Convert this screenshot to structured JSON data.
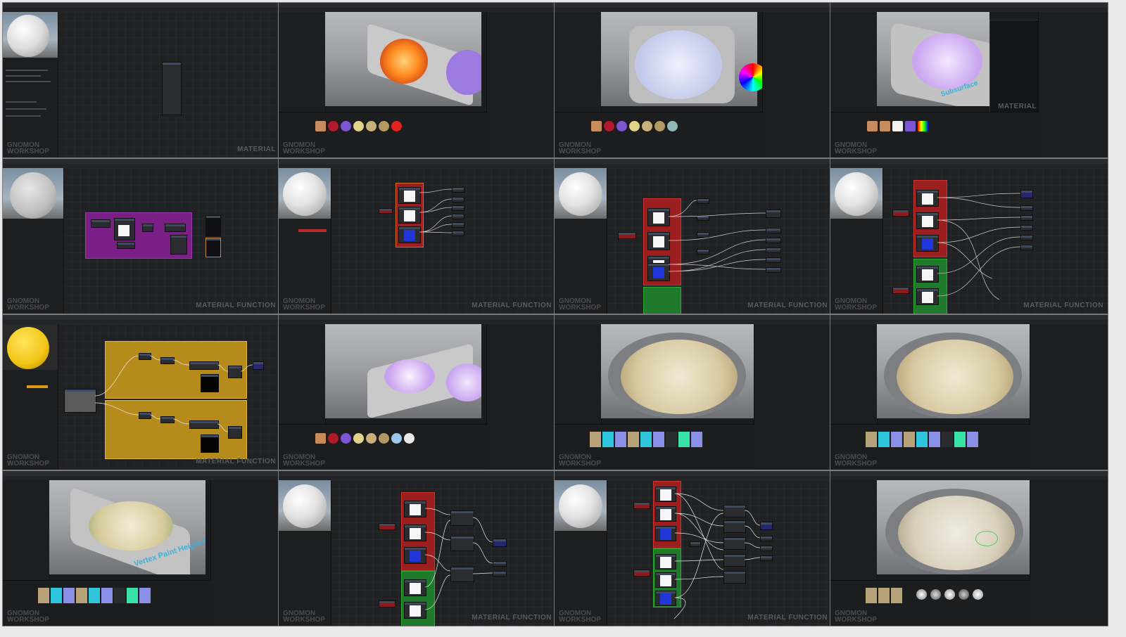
{
  "sheet": {
    "tile_count": 16
  },
  "watermarks": {
    "material": "MATERIAL",
    "material_function": "MATERIAL FUNCTION"
  },
  "logo": {
    "line1": "GNOMON",
    "line2": "WORKSHOP"
  },
  "viewport_labels": {
    "subsurface": "Subsurface",
    "vertex_paint": "Vertex Paint Height Bl"
  },
  "colors": {
    "editor_bg": "#202123",
    "comment_purple": "#7a1f86",
    "comment_red": "#9b1f1f",
    "comment_green": "#1f7a2c",
    "comment_yellow": "#b58c1c",
    "accent_blue": "#2136d8"
  }
}
